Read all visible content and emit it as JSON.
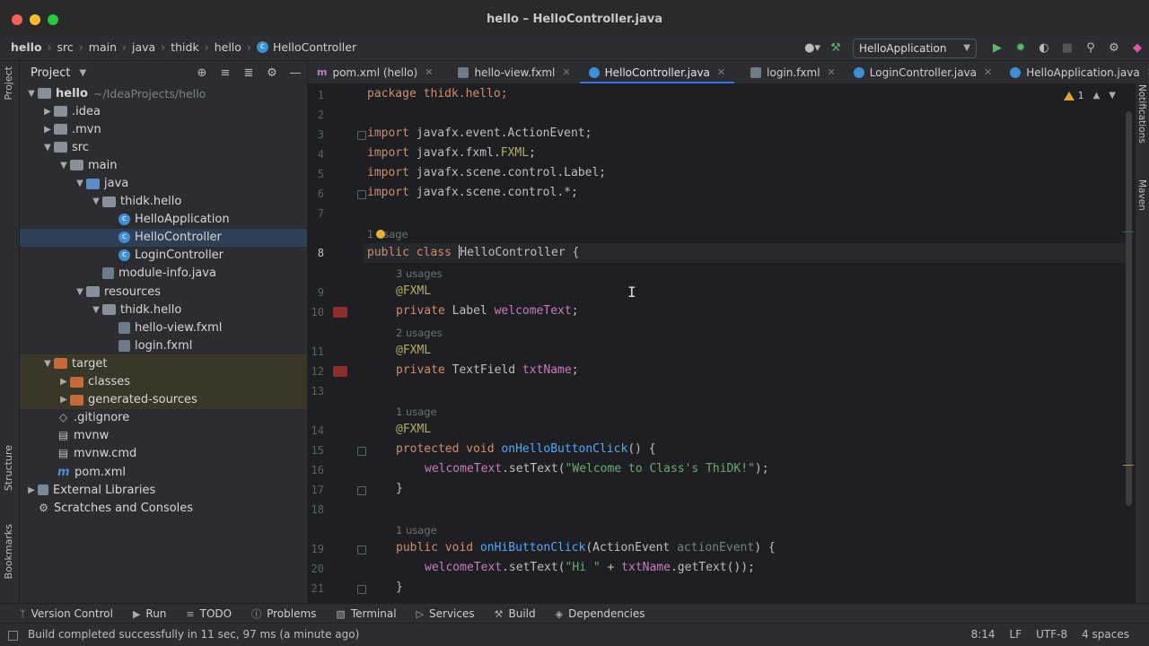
{
  "window": {
    "title": "hello – HelloController.java"
  },
  "breadcrumb": [
    "hello",
    "src",
    "main",
    "java",
    "thidk",
    "hello",
    "HelloController"
  ],
  "run_config": {
    "label": "HelloApplication"
  },
  "left_stripe": {
    "project": "Project",
    "structure": "Structure",
    "bookmarks": "Bookmarks"
  },
  "right_stripe": {
    "notifications": "Notifications",
    "maven": "Maven"
  },
  "project_panel": {
    "title": "Project"
  },
  "tree": [
    {
      "label": "hello",
      "extra": "~/IdeaProjects/hello"
    },
    {
      "label": ".idea"
    },
    {
      "label": ".mvn"
    },
    {
      "label": "src"
    },
    {
      "label": "main"
    },
    {
      "label": "java"
    },
    {
      "label": "thidk.hello"
    },
    {
      "label": "HelloApplication"
    },
    {
      "label": "HelloController"
    },
    {
      "label": "LoginController"
    },
    {
      "label": "module-info.java"
    },
    {
      "label": "resources"
    },
    {
      "label": "thidk.hello"
    },
    {
      "label": "hello-view.fxml"
    },
    {
      "label": "login.fxml"
    },
    {
      "label": "target"
    },
    {
      "label": "classes"
    },
    {
      "label": "generated-sources"
    },
    {
      "label": ".gitignore"
    },
    {
      "label": "mvnw"
    },
    {
      "label": "mvnw.cmd"
    },
    {
      "label": "pom.xml"
    },
    {
      "label": "External Libraries"
    },
    {
      "label": "Scratches and Consoles"
    }
  ],
  "tabs": [
    "pom.xml (hello)",
    "hello-view.fxml",
    "HelloController.java",
    "login.fxml",
    "LoginController.java",
    "HelloApplication.java"
  ],
  "editor": {
    "warnings": "1",
    "lines": [
      "1",
      "2",
      "3",
      "4",
      "5",
      "6",
      "7",
      "8",
      "9",
      "10",
      "11",
      "12",
      "13",
      "14",
      "15",
      "16",
      "17",
      "18",
      "19",
      "20",
      "21"
    ],
    "hints": [
      "1 usage",
      "3 usages",
      "2 usages",
      "1 usage",
      "1 usage"
    ],
    "code": {
      "l1": "package thidk.hello;",
      "l3": "javafx.event.ActionEvent;",
      "l4a": "javafx.fxml.",
      "l4b": "FXML",
      "l4c": ";",
      "l5": "javafx.scene.control.Label;",
      "l6": "javafx.scene.control.*;",
      "import": "import",
      "public": "public",
      "class": "class",
      "cls_a": "H",
      "cls_b": "elloController",
      "brace": " {",
      "at_fxml": "@FXML",
      "private": "private",
      "protected": "protected",
      "void": "void",
      "l10type": "Label",
      "l10field": "welcomeText",
      "l12type": "TextField",
      "l12field": "txtName",
      "l15fn": "onHelloButtonClick",
      "l15rest": "() {",
      "l16a": "welcomeText",
      "l16b": ".setText(",
      "l16s": "\"Welcome to Class's ThiDK!\"",
      "l16c": ");",
      "l19fn": "onHiButtonClick",
      "l19a": "(ActionEvent ",
      "l19p": "actionEvent",
      "l19b": ") {",
      "l20a": "welcomeText",
      "l20b": ".setText(",
      "l20s": "\"Hi \"",
      "l20c": " + ",
      "l20d": "txtName",
      "l20e": ".getText());",
      "close": "}"
    }
  },
  "bottom_tools": [
    "Version Control",
    "Run",
    "TODO",
    "Problems",
    "Terminal",
    "Services",
    "Build",
    "Dependencies"
  ],
  "status": {
    "message": "Build completed successfully in 11 sec, 97 ms (a minute ago)",
    "position": "8:14",
    "line_sep": "LF",
    "encoding": "UTF-8",
    "indent": "4 spaces"
  },
  "colors": {
    "accent": "#3574f0",
    "keyword": "#cf8e6d",
    "annotation": "#b3ae60",
    "field": "#c77dbb",
    "function": "#56a8f5",
    "string": "#6aab73"
  }
}
